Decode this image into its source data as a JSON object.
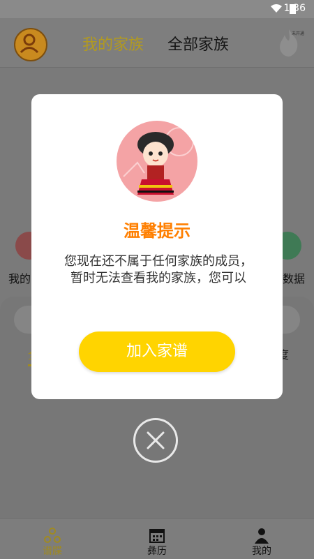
{
  "status_bar": {
    "time": "1:36"
  },
  "header": {
    "tab_mine": "我的家族",
    "tab_all": "全部家族",
    "fire_label": "未开通"
  },
  "background": {
    "left_label": "我的",
    "right_label": "数据",
    "tab_left": "全",
    "tab_right": "度"
  },
  "dialog": {
    "title": "温馨提示",
    "message": "您现在还不属于任何家族的成员，暂时无法查看我的家族，您可以",
    "button": "加入家谱"
  },
  "bottom_nav": [
    {
      "label": "谱牒",
      "icon": "genealogy-icon"
    },
    {
      "label": "彝历",
      "icon": "calendar-icon"
    },
    {
      "label": "我的",
      "icon": "person-icon"
    }
  ]
}
